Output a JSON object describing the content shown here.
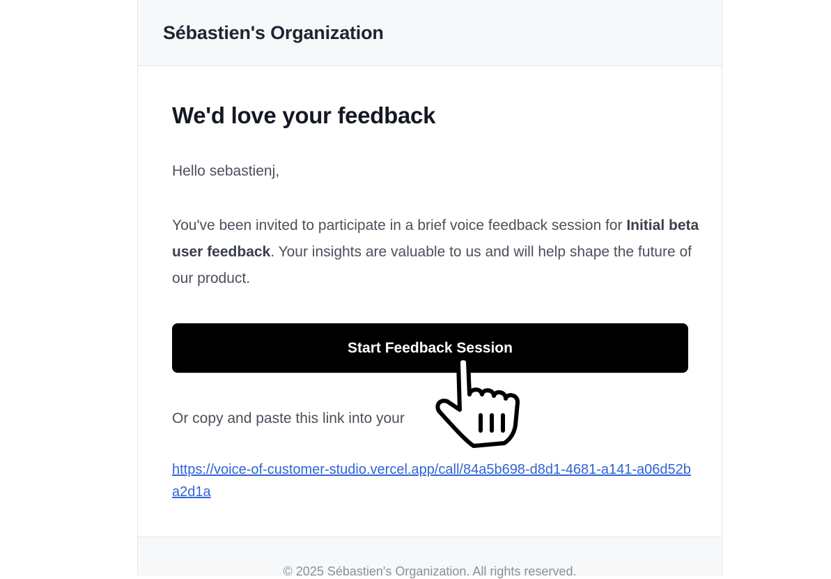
{
  "header": {
    "org_name": "Sébastien's Organization"
  },
  "email": {
    "title": "We'd love your feedback",
    "greeting": "Hello sebastienj,",
    "body_pre": "You've been invited to participate in a brief voice feedback session for ",
    "body_bold": "Initial beta user feedback",
    "body_post": ". Your insights are valuable to us and will help shape the future of our product.",
    "cta_label": "Start Feedback Session",
    "copy_text": "Or copy and paste this link into your",
    "link": "https://voice-of-customer-studio.vercel.app/call/84a5b698-d8d1-4681-a141-a06d52ba2d1a"
  },
  "footer": {
    "text": "© 2025 Sébastien's Organization. All rights reserved."
  },
  "icons": {
    "cursor": "hand-pointer-icon"
  },
  "colors": {
    "button_bg": "#000000",
    "link": "#2f63d8",
    "header_bg": "#f7f8fa"
  }
}
